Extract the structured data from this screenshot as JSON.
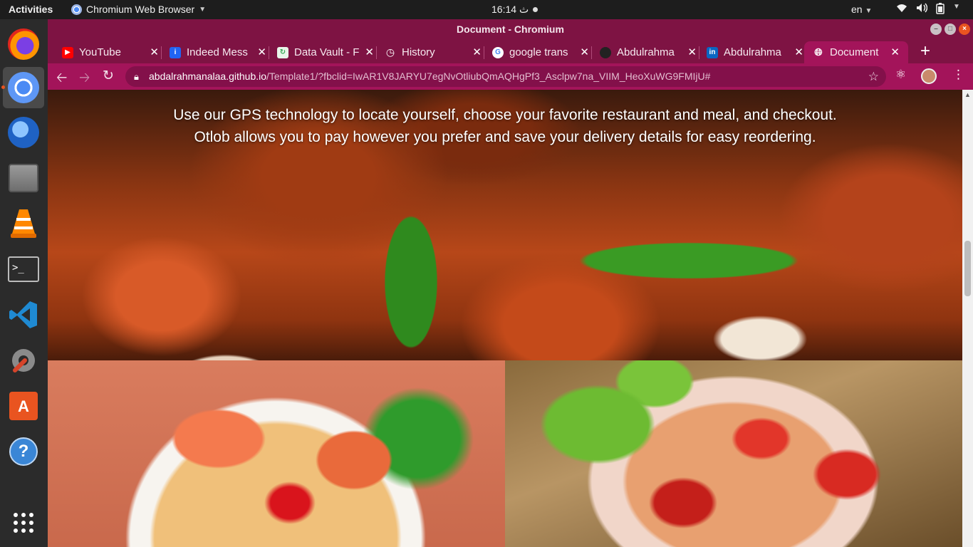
{
  "topbar": {
    "activities": "Activities",
    "app_name": "Chromium Web Browser",
    "clock": "16:14 ث",
    "language": "en"
  },
  "dock": {
    "apps": [
      {
        "name": "Firefox",
        "icon": "firefox-icon"
      },
      {
        "name": "Chromium",
        "icon": "chromium-icon",
        "active": true
      },
      {
        "name": "Thunderbird",
        "icon": "thunderbird-icon"
      },
      {
        "name": "Files",
        "icon": "files-icon"
      },
      {
        "name": "VLC",
        "icon": "vlc-icon"
      },
      {
        "name": "Terminal",
        "icon": "terminal-icon"
      },
      {
        "name": "Visual Studio Code",
        "icon": "vscode-icon"
      },
      {
        "name": "Settings",
        "icon": "settings-icon"
      },
      {
        "name": "Software",
        "icon": "software-center-icon"
      },
      {
        "name": "Help",
        "icon": "help-icon"
      },
      {
        "name": "Show Applications",
        "icon": "app-grid-icon"
      }
    ]
  },
  "window": {
    "title": "Document - Chromium"
  },
  "tabs": [
    {
      "label": "YouTube",
      "icon": "youtube-icon",
      "color": "#ff0000"
    },
    {
      "label": "Indeed Mess",
      "icon": "indeed-icon",
      "color": "#2164f3"
    },
    {
      "label": "Data Vault - F",
      "icon": "data-vault-icon",
      "color": "#34a853"
    },
    {
      "label": "History",
      "icon": "history-icon",
      "color": "#ffffff"
    },
    {
      "label": "google trans",
      "icon": "google-icon",
      "color": "#4285f4"
    },
    {
      "label": "Abdulrahma",
      "icon": "github-icon",
      "color": "#222222"
    },
    {
      "label": "Abdulrahma",
      "icon": "linkedin-icon",
      "color": "#0a66c2"
    },
    {
      "label": "Document",
      "icon": "globe-icon",
      "color": "#ffffff",
      "active": true
    }
  ],
  "toolbar": {
    "url_host": "abdalrahmanalaa.github.io",
    "url_path": "/Template1/?fbclid=IwAR1V8JARYU7egNvOtliubQmAQHgPf3_Asclpw7na_VIIM_HeoXuWG9FMIjU#"
  },
  "page": {
    "hero_caption_line1": "Use our GPS technology to locate yourself, choose your favorite restaurant and meal, and checkout.",
    "hero_caption_line2": "Otlob allows you to pay however you prefer and save your delivery details for easy reordering."
  },
  "theme": {
    "accent": "#a3145a",
    "frame": "#7e1343",
    "ubuntu_orange": "#e95420"
  }
}
